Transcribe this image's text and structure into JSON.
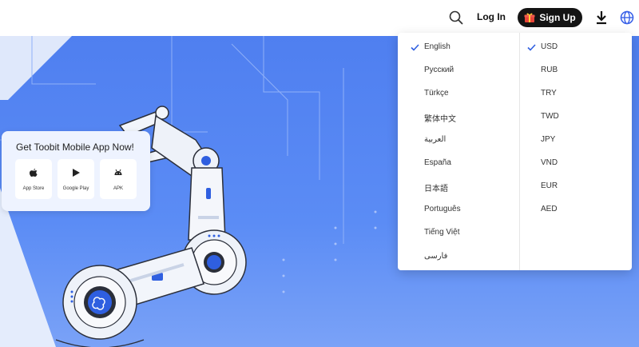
{
  "header": {
    "login_label": "Log In",
    "signup_label": "Sign Up",
    "icons": [
      "search-icon",
      "gift-icon",
      "download-icon",
      "globe-icon"
    ]
  },
  "app_card": {
    "title": "Get Toobit Mobile App Now!",
    "tiles": [
      {
        "label": "App Store",
        "icon": "apple-icon"
      },
      {
        "label": "Google Play",
        "icon": "play-icon"
      },
      {
        "label": "APK",
        "icon": "android-icon"
      }
    ]
  },
  "languages": {
    "selected": "English",
    "items": [
      "English",
      "Русский",
      "Türkçe",
      "繁体中文",
      "العربية",
      "España",
      "日本語",
      "Português",
      "Tiếng Việt",
      "فارسی"
    ]
  },
  "currencies": {
    "selected": "USD",
    "items": [
      "USD",
      "RUB",
      "TRY",
      "TWD",
      "JPY",
      "VND",
      "EUR",
      "AED"
    ]
  },
  "colors": {
    "accent": "#3a62e8",
    "hero_blue": "#5b8cf5",
    "signup_bg": "#141414"
  }
}
